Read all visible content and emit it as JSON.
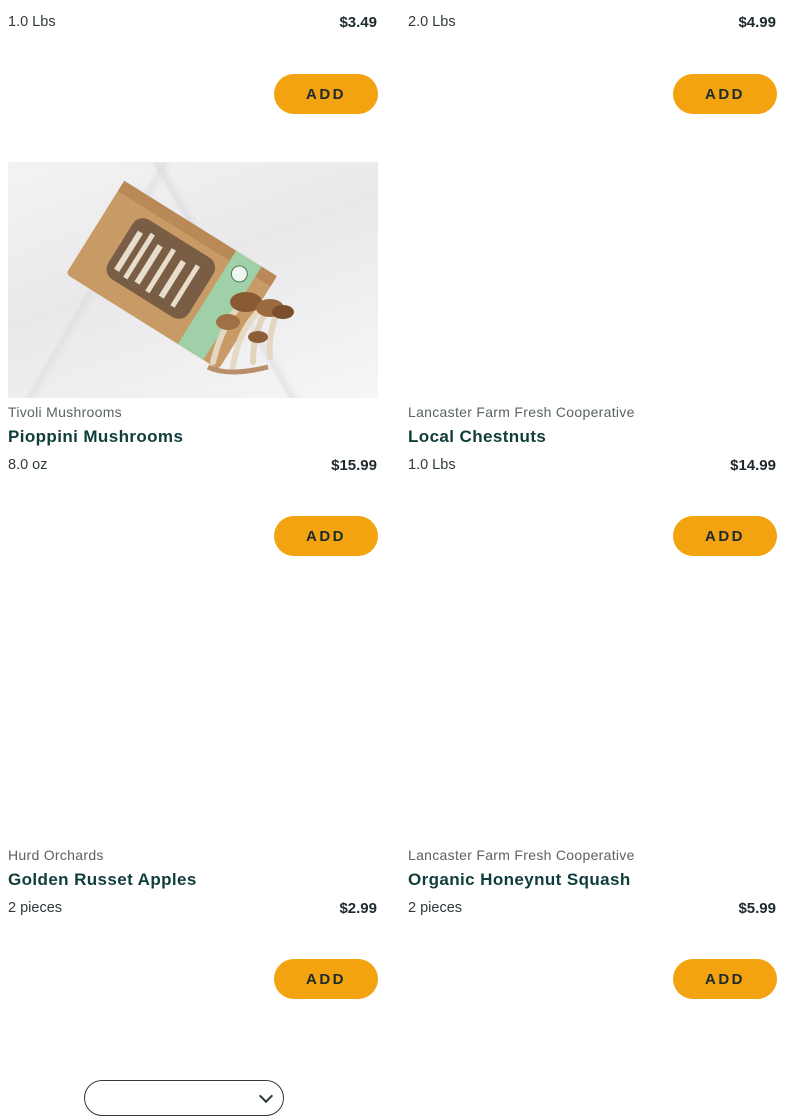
{
  "products": [
    {
      "brand": "",
      "name": "",
      "qty": "1.0 Lbs",
      "price": "$3.49",
      "add": "ADD"
    },
    {
      "brand": "",
      "name": "",
      "qty": "2.0 Lbs",
      "price": "$4.99",
      "add": "ADD"
    },
    {
      "brand": "Tivoli Mushrooms",
      "name": "Pioppini Mushrooms",
      "qty": "8.0 oz",
      "price": "$15.99",
      "add": "ADD",
      "image": "pioppini-mushrooms-box-photo",
      "package_label": "Pioppini Mushrooms"
    },
    {
      "brand": "Lancaster Farm Fresh Cooperative",
      "name": "Local Chestnuts",
      "qty": "1.0 Lbs",
      "price": "$14.99",
      "add": "ADD"
    },
    {
      "brand": "Hurd Orchards",
      "name": "Golden Russet Apples",
      "qty": "2 pieces",
      "price": "$2.99",
      "add": "ADD"
    },
    {
      "brand": "Lancaster Farm Fresh Cooperative",
      "name": "Organic Honeynut Squash",
      "qty": "2 pieces",
      "price": "$5.99",
      "add": "ADD"
    }
  ],
  "footer": {
    "label": "",
    "select_value": ""
  },
  "colors": {
    "add_button": "#f2a30f",
    "product_name": "#0f3d3a"
  }
}
